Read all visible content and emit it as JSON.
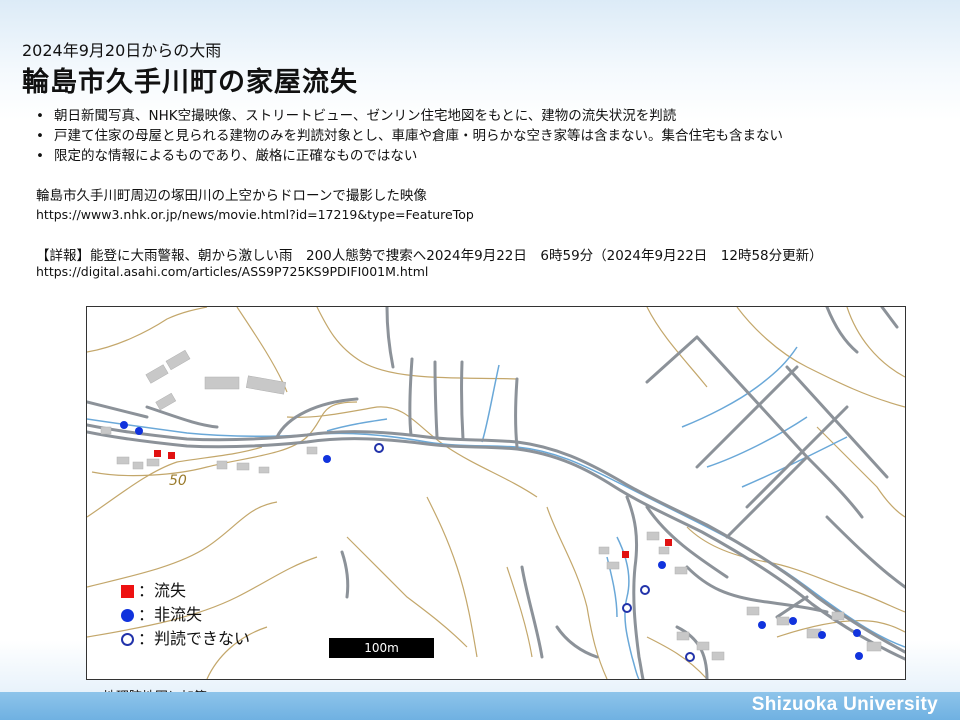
{
  "slide": {
    "subtitle": "2024年9月20日からの大雨",
    "title": "輪島市久手川町の家屋流失"
  },
  "bullets": [
    "朝日新聞写真、NHK空撮映像、ストリートビュー、ゼンリン住宅地図をもとに、建物の流失状況を判読",
    "戸建て住家の母屋と見られる建物のみを判読対象とし、車庫や倉庫・明らかな空き家等は含まない。集合住宅も含まない",
    "限定的な情報によるものであり、厳格に正確なものではない"
  ],
  "sources": [
    {
      "text": "輪島市久手川町周辺の塚田川の上空からドローンで撮影した映像",
      "url": "https://www3.nhk.or.jp/news/movie.html?id=17219&type=FeatureTop"
    },
    {
      "text": "【詳報】能登に大雨警報、朝から激しい雨　200人態勢で捜索へ2024年9月22日　6時59分（2024年9月22日　12時58分更新）",
      "url": "https://digital.asahi.com/articles/ASS9P725KS9PDIFI001M.html"
    }
  ],
  "map": {
    "contour_label": "50",
    "scale_label": "100m",
    "legend": [
      {
        "symbol": "red-square",
        "label": "：流失"
      },
      {
        "symbol": "blue-circle",
        "label": "：非流失"
      },
      {
        "symbol": "blue-ring",
        "label": "：判読できない"
      }
    ],
    "colors": {
      "washed_away": "#e11111",
      "not_washed_away": "#1133dd",
      "undetermined": "#2233aa",
      "river": "#6aa8d8",
      "contour": "#b08a3a",
      "road": "#8c9299",
      "building": "#c8c8c8"
    }
  },
  "credit": "地理院地図に加筆",
  "footer": {
    "brand": "Shizuoka University"
  }
}
